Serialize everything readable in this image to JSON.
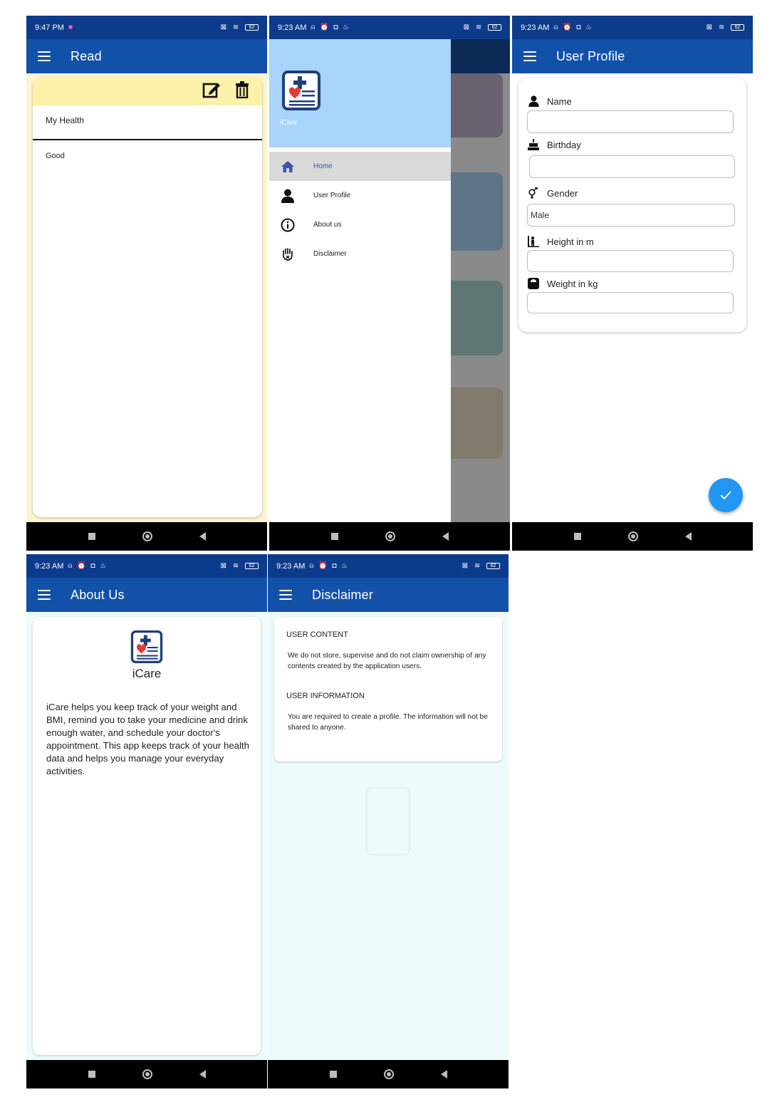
{
  "colors": {
    "status_bar": "#0d3b8c",
    "app_bar": "#1251a8",
    "note_background": "#fdf5cf",
    "note_header": "#fbf1a9",
    "drawer_header": "#a8d4fb",
    "drawer_active": "#d9d9d9",
    "fab": "#2196f3",
    "light_background": "#eefbfd"
  },
  "status_bars": {
    "read_time": "9:47 PM",
    "other_time": "9:23 AM",
    "battery": "62"
  },
  "read_screen": {
    "title": "Read",
    "toolbar_icons": [
      "edit-icon",
      "delete-icon"
    ],
    "note_title": "My Health",
    "note_body": "Good"
  },
  "drawer_screen": {
    "app_name": "iCare",
    "menu": [
      {
        "label": "Home",
        "icon": "home-icon",
        "active": true
      },
      {
        "label": "User Profile",
        "icon": "person-icon",
        "active": false
      },
      {
        "label": "About us",
        "icon": "info-icon",
        "active": false
      },
      {
        "label": "Disclaimer",
        "icon": "hand-icon",
        "active": false
      }
    ]
  },
  "profile_screen": {
    "title": "User Profile",
    "fields": [
      {
        "label": "Name",
        "icon": "person-icon",
        "value": ""
      },
      {
        "label": "Birthday",
        "icon": "cake-icon",
        "value": ""
      },
      {
        "label": "Gender",
        "icon": "gender-icon",
        "value": "Male"
      },
      {
        "label": "Height in m",
        "icon": "height-icon",
        "value": ""
      },
      {
        "label": "Weight in kg",
        "icon": "scale-icon",
        "value": ""
      }
    ],
    "fab_icon": "check-icon"
  },
  "about_screen": {
    "title": "About Us",
    "app_name": "iCare",
    "description": "iCare helps you keep track of your weight and BMI, remind you to take your medicine and drink enough water, and schedule your doctor's appointment. This app keeps track of your health data and helps you manage your everyday activities."
  },
  "disclaimer_screen": {
    "title": "Disclaimer",
    "sections": [
      {
        "heading": "USER CONTENT",
        "text": "We do not store, supervise and do not claim ownership of any contents created by the application users."
      },
      {
        "heading": "USER INFORMATION",
        "text": "You are required to create a profile. The information will not be shared to anyone."
      }
    ]
  }
}
